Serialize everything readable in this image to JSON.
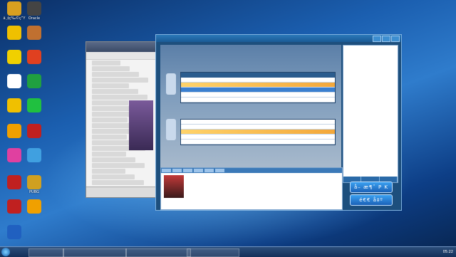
{
  "desktop": {
    "icons": [
      {
        "label": "ä¸‡ç‰©ç”Ÿ",
        "name": "app-icon-1",
        "color": "#d8a020"
      },
      {
        "label": "Oracle",
        "name": "app-icon-2",
        "color": "#444444"
      },
      {
        "label": "",
        "name": "app-icon-3",
        "color": "#f0c000"
      },
      {
        "label": "",
        "name": "app-icon-4",
        "color": "#c07030"
      },
      {
        "label": "",
        "name": "app-icon-5",
        "color": "#f0d000"
      },
      {
        "label": "",
        "name": "app-icon-6",
        "color": "#e04020"
      },
      {
        "label": "",
        "name": "app-icon-7",
        "color": "#ffffff"
      },
      {
        "label": "",
        "name": "app-icon-8",
        "color": "#20a040"
      },
      {
        "label": "",
        "name": "app-icon-9",
        "color": "#f0c000"
      },
      {
        "label": "",
        "name": "app-icon-10",
        "color": "#20c040"
      },
      {
        "label": "",
        "name": "app-icon-11",
        "color": "#f0a000"
      },
      {
        "label": "",
        "name": "app-icon-12",
        "color": "#c02020"
      },
      {
        "label": "",
        "name": "app-icon-13",
        "color": "#e040a0"
      },
      {
        "label": "",
        "name": "app-icon-14",
        "color": "#40a0e0"
      },
      {
        "label": "",
        "name": "app-icon-15",
        "color": "#c02020"
      },
      {
        "label": "PUBG",
        "name": "app-icon-16",
        "color": "#d0a020"
      },
      {
        "label": "",
        "name": "app-icon-17",
        "color": "#c02020"
      },
      {
        "label": "",
        "name": "app-icon-18",
        "color": "#f0a000"
      },
      {
        "label": "",
        "name": "app-icon-19",
        "color": "#2060c0"
      }
    ]
  },
  "game_window": {
    "title": "",
    "right_panel": {
      "rows": [
        {
          "k": "",
          "v": ""
        },
        {
          "k": "",
          "v": ""
        },
        {
          "k": "",
          "v": ""
        },
        {
          "k": "",
          "v": ""
        },
        {
          "k": "",
          "v": ""
        },
        {
          "k": "",
          "v": ""
        },
        {
          "k": "",
          "v": ""
        },
        {
          "k": "",
          "v": ""
        },
        {
          "k": "",
          "v": ""
        },
        {
          "k": "",
          "v": ""
        },
        {
          "k": "",
          "v": ""
        },
        {
          "k": "",
          "v": ""
        }
      ],
      "tabs": [
        "",
        "",
        ""
      ]
    },
    "cancel_pk": "å– æ¶ˆ P K",
    "exit": "é€€ å‡º"
  },
  "taskbar": {
    "items": [
      "",
      "",
      "",
      ""
    ],
    "time": "05:22"
  },
  "colors": {
    "highlight_row": "#f3a73a",
    "selected_row": "#3a7fd0",
    "accent": "#1b62b8"
  }
}
